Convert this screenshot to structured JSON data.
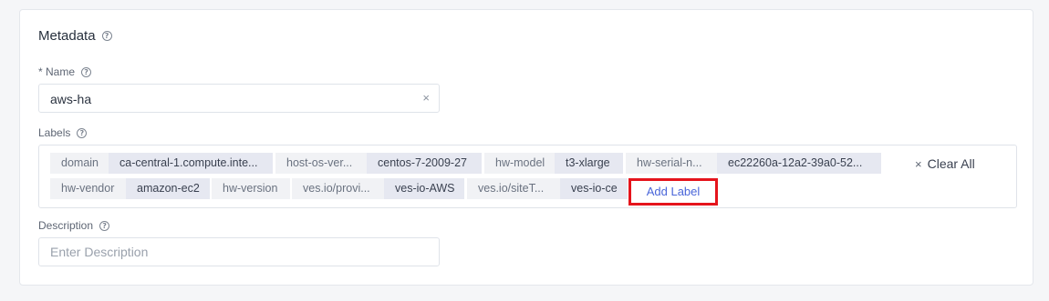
{
  "metadata": {
    "title": "Metadata",
    "name_label": "* Name",
    "name_value": "aws-ha",
    "labels_label": "Labels",
    "description_label": "Description",
    "description_placeholder": "Enter Description",
    "clear_icon": "×",
    "help_icon": "?"
  },
  "labels": {
    "row1": [
      {
        "key": "domain",
        "value": "ca-central-1.compute.inte..."
      },
      {
        "key": "host-os-ver...",
        "value": "centos-7-2009-27"
      },
      {
        "key": "hw-model",
        "value": "t3-xlarge"
      },
      {
        "key": "hw-serial-n...",
        "value": "ec22260a-12a2-39a0-52..."
      }
    ],
    "row2": [
      {
        "key": "hw-vendor",
        "value": "amazon-ec2"
      },
      {
        "key": "hw-version",
        "value": ""
      },
      {
        "key": "ves.io/provi...",
        "value": "ves-io-AWS"
      },
      {
        "key": "ves.io/siteT...",
        "value": "ves-io-ce"
      }
    ],
    "add_label": "Add Label",
    "clear_all": "Clear All"
  },
  "colors": {
    "highlight": "#e5141c",
    "link": "#4a66d9"
  }
}
